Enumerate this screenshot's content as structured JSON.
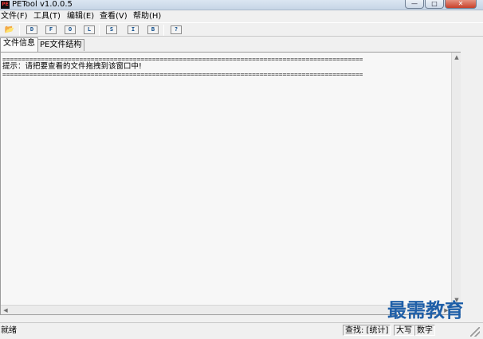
{
  "window": {
    "title": "PETool v1.0.0.5",
    "icon": "app-icon",
    "app_icon_text": "PE",
    "minimize_glyph": "—",
    "maximize_glyph": "□",
    "close_glyph": "✕"
  },
  "menu": {
    "items": [
      {
        "label": "文件(F)"
      },
      {
        "label": "工具(T)"
      },
      {
        "label": "编辑(E)"
      },
      {
        "label": "查看(V)"
      },
      {
        "label": "帮助(H)"
      }
    ]
  },
  "toolbar": {
    "open_icon": "folder-open-icon",
    "open_glyph": "📂",
    "buttons": [
      {
        "label": "D"
      },
      {
        "label": "F"
      },
      {
        "label": "O"
      },
      {
        "label": "L"
      },
      {
        "label": "S"
      },
      {
        "label": "I"
      },
      {
        "label": "B"
      },
      {
        "label": "?"
      }
    ]
  },
  "tabs": [
    {
      "label": "文件信息",
      "active": true
    },
    {
      "label": "PE文件结构",
      "active": false
    }
  ],
  "content": {
    "separator": "==============================================================================================",
    "hint": "提示：请把要查看的文件拖拽到该窗口中!"
  },
  "scroll_glyphs": {
    "up": "▲",
    "down": "▼",
    "left": "◀",
    "right": "▶"
  },
  "watermark": {
    "text": "最需教育",
    "color": "#1f5fa8"
  },
  "status": {
    "text": "就绪",
    "panes": [
      {
        "label": "查找: [统计]"
      },
      {
        "label": "大写"
      },
      {
        "label": "数字"
      }
    ]
  }
}
